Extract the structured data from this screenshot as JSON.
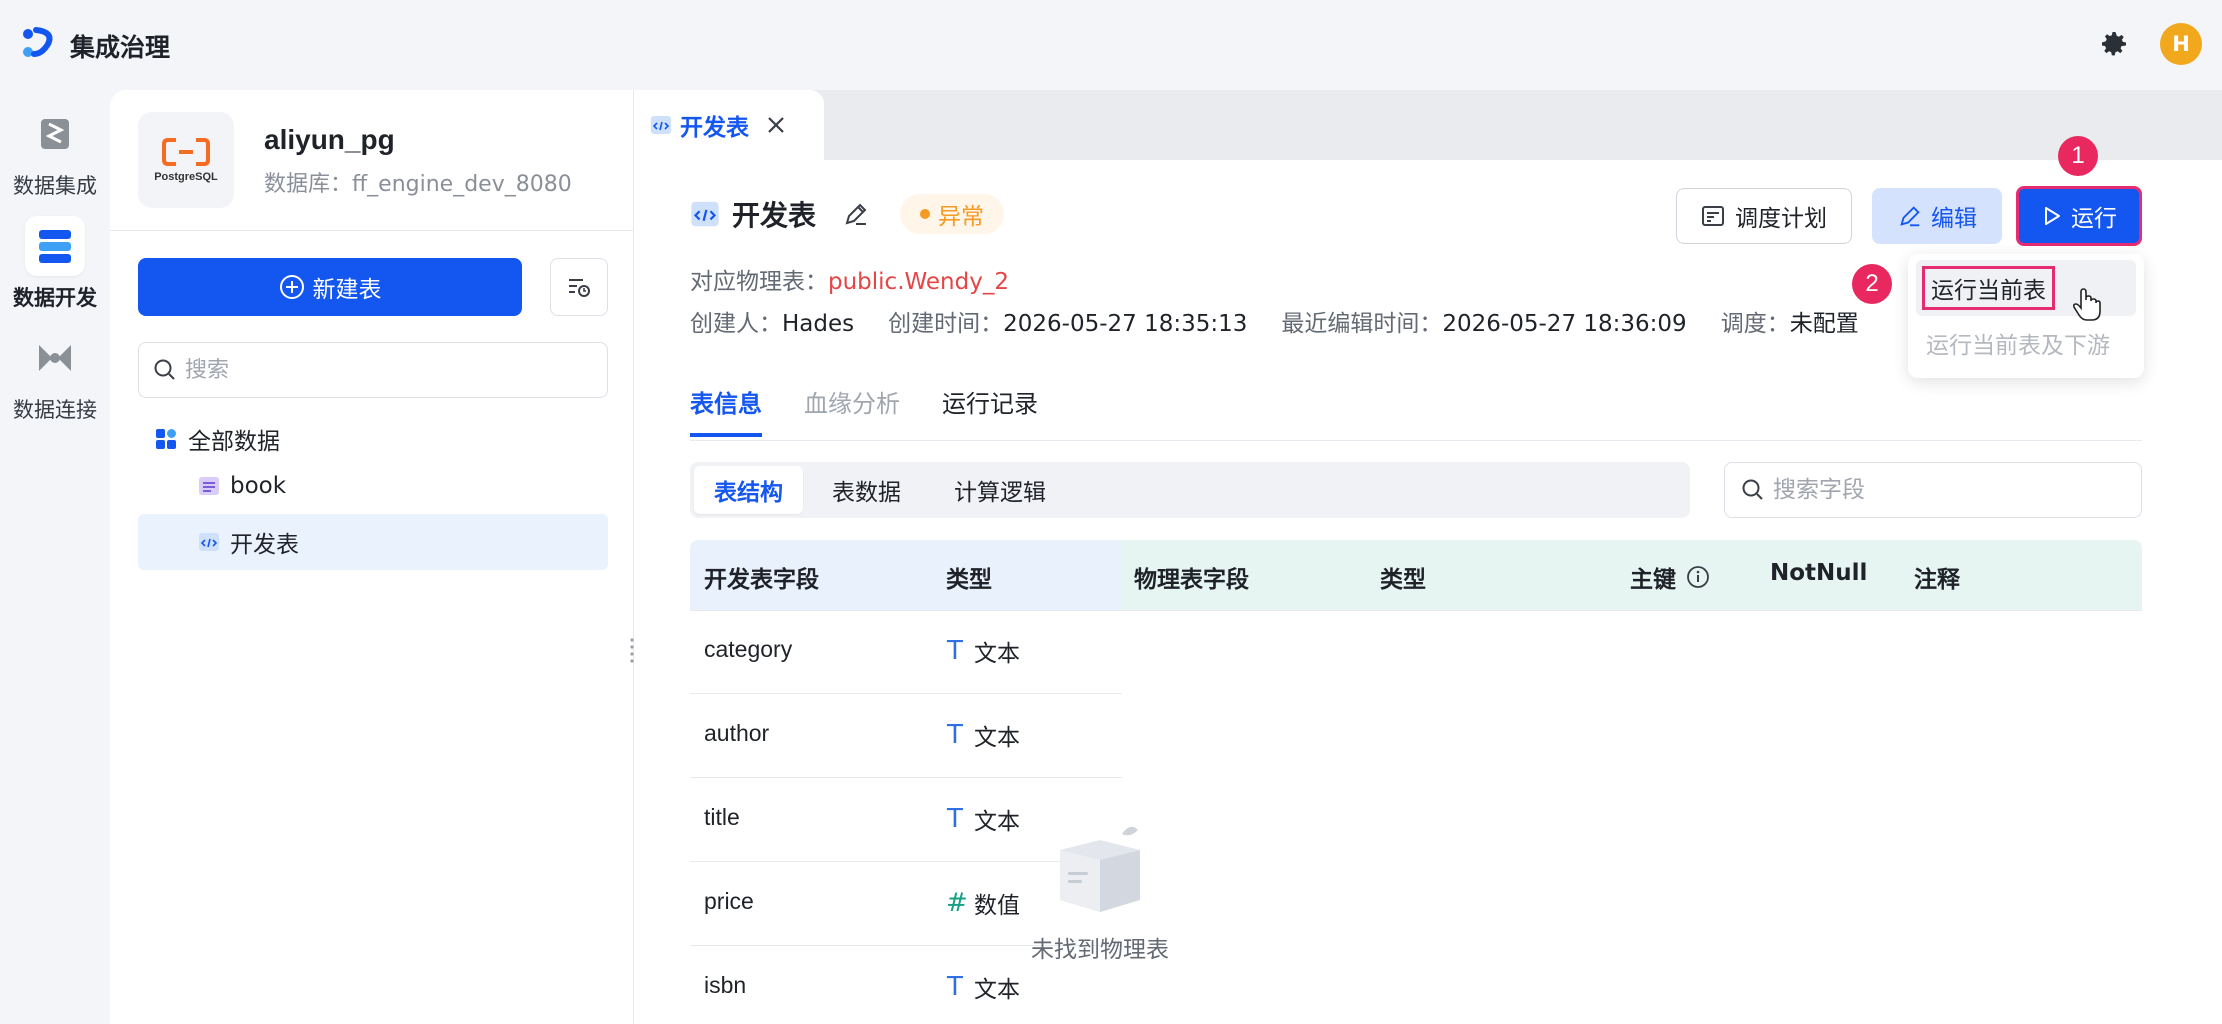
{
  "app": {
    "title": "集成治理",
    "avatar_letter": "H",
    "accent": "#1456f0"
  },
  "leftnav": {
    "items": [
      {
        "label": "数据集成",
        "icon": "data-integration-icon"
      },
      {
        "label": "数据开发",
        "icon": "data-development-icon",
        "active": true
      },
      {
        "label": "数据连接",
        "icon": "data-connection-icon"
      }
    ]
  },
  "sidebar": {
    "datasource": {
      "name": "aliyun_pg",
      "db_label": "数据库：ff_engine_dev_8080",
      "logo_text": "PostgreSQL"
    },
    "new_button": "新建表",
    "search_placeholder": "搜索",
    "tree": {
      "root": "全部数据",
      "items": [
        {
          "label": "book"
        },
        {
          "label": "开发表",
          "selected": true
        }
      ]
    }
  },
  "main": {
    "tab": {
      "label": "开发表"
    },
    "title": "开发表",
    "status": "异常",
    "physical_table_label": "对应物理表：",
    "physical_table_value": "public.Wendy_2",
    "meta": {
      "creator_label": "创建人：",
      "creator": "Hades",
      "created_label": "创建时间：",
      "created": "2026-05-27 18:35:13",
      "edited_label": "最近编辑时间：",
      "edited": "2026-05-27 18:36:09",
      "schedule_label": "调度：",
      "schedule": "未配置"
    },
    "buttons": {
      "schedule": "调度计划",
      "edit": "编辑",
      "run": "运行"
    },
    "steps": {
      "one": "1",
      "two": "2"
    },
    "run_menu": {
      "current": "运行当前表",
      "downstream": "运行当前表及下游"
    },
    "tabs": [
      {
        "label": "表信息",
        "active": true
      },
      {
        "label": "血缘分析",
        "disabled": true
      },
      {
        "label": "运行记录"
      }
    ],
    "segments": [
      {
        "label": "表结构",
        "active": true
      },
      {
        "label": "表数据"
      },
      {
        "label": "计算逻辑"
      }
    ],
    "field_search_placeholder": "搜索字段",
    "table": {
      "headers": {
        "dev_field": "开发表字段",
        "dev_type": "类型",
        "phys_field": "物理表字段",
        "phys_type": "类型",
        "pk": "主键",
        "notnull": "NotNull",
        "comment": "注释"
      },
      "rows": [
        {
          "field": "category",
          "type": "文本",
          "type_kind": "text"
        },
        {
          "field": "author",
          "type": "文本",
          "type_kind": "text"
        },
        {
          "field": "title",
          "type": "文本",
          "type_kind": "text"
        },
        {
          "field": "price",
          "type": "数值",
          "type_kind": "number"
        },
        {
          "field": "isbn",
          "type": "文本",
          "type_kind": "text"
        }
      ]
    },
    "empty_text": "未找到物理表"
  }
}
